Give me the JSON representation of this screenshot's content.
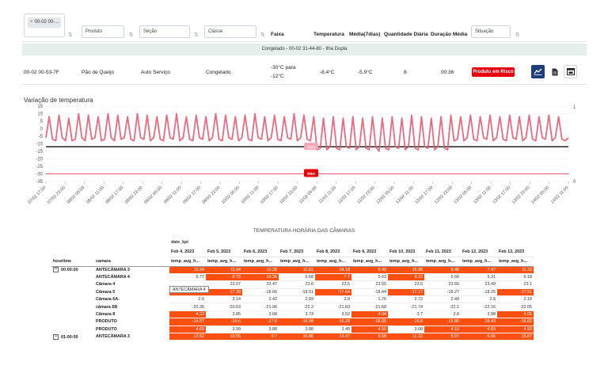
{
  "filters": {
    "chip_value": "00-02 00-...",
    "produto_placeholder": "Produto",
    "secao_placeholder": "Seção",
    "classe_placeholder": "Classe",
    "situacao_placeholder": "Situação"
  },
  "columns": {
    "faixa": "Faixa",
    "temperatura": "Temperatura",
    "media": "Média(7dias)",
    "quantidade": "Quantidade Diária",
    "duracao": "Duração Média"
  },
  "group_band": "Congelado - 00-02 31-44-80 - Ilha Dupla",
  "row": {
    "id": "00-02 00-53-7F",
    "produto": "Pão de Queijo",
    "secao": "Auto Serviço",
    "classe": "Congelado",
    "faixa_line1": "-30°C para",
    "faixa_line2": "-12°C",
    "temperatura": "-8.4°C",
    "media": "-5.9°C",
    "quantidade": "8",
    "duracao": "00:36",
    "situacao": "Produto em Risco"
  },
  "icons": {
    "chart": "line-chart-icon",
    "doc": "document-icon",
    "window": "window-icon",
    "close": "close-icon",
    "sort": "sort-icon"
  },
  "colors": {
    "series": "#e85a71",
    "max_line": "#111111",
    "min_line": "#e85a71",
    "risk_badge": "#e8000b",
    "accent_button": "#1f3d7a",
    "cell_hot": "#fc4f10"
  },
  "chart_data": {
    "type": "line",
    "title": "Variação de temperatura",
    "ylim": [
      -35,
      15
    ],
    "yticks": [
      15,
      10,
      5,
      0,
      -5,
      -10,
      -15,
      -20,
      -25,
      -30,
      -35
    ],
    "secondary_yticks": [
      "1",
      "0"
    ],
    "x_tick_labels": [
      "07/02 17:00",
      "07/02 23:00",
      "08/02 05:00",
      "08/02 11:00",
      "08/02 17:00",
      "08/02 23:00",
      "09/02 05:00",
      "09/02 11:00",
      "09/02 17:00",
      "09/02 23:00",
      "10/02 05:00",
      "10/02 11:00",
      "10/02 17:00",
      "10/02 23:00",
      "11/02 05:00",
      "11/02 11:00",
      "11/02 17:00",
      "11/02 23:00",
      "12/02 05:00",
      "12/02 11:00",
      "12/02 17:00",
      "12/02 23:00",
      "13/02 05:00",
      "13/02 11:00",
      "13/02 17:00",
      "13/02 23:00",
      "14/02 05:00",
      "14/02 11:00"
    ],
    "max_line": -12,
    "min_line": -30,
    "max_label": "max",
    "min_label": "min",
    "series": [
      {
        "values": [
          -6,
          8,
          -7,
          -8,
          9,
          -6,
          -8,
          7,
          -8,
          -7,
          10,
          -6,
          -8,
          9,
          -7,
          -6,
          8,
          -8,
          -7,
          10,
          -6,
          -8,
          9,
          -7,
          -6,
          8,
          -7,
          -8,
          10,
          -6,
          -7,
          9,
          -8,
          -6,
          8,
          -7,
          -8,
          9,
          -6,
          -7,
          10,
          -8,
          -6,
          8,
          -7,
          -8,
          9,
          -6,
          -7,
          8,
          -8,
          -6,
          10,
          -7,
          -8,
          9,
          -6,
          -7,
          8,
          -8,
          -6,
          9,
          -7,
          -8,
          10,
          -6,
          -7,
          8,
          -8,
          -6,
          9,
          -7,
          -8,
          8,
          -6,
          -7,
          10,
          -8,
          -6,
          9,
          -7,
          -8,
          8,
          -14,
          -13,
          7,
          -14,
          -12,
          8,
          -13,
          -14,
          7,
          -12,
          -13,
          8,
          -14,
          -12,
          7,
          -13,
          -14,
          8,
          -12,
          -15,
          7,
          -13,
          -14,
          8,
          -12,
          -13,
          7,
          -14,
          -12,
          9,
          -13,
          -14,
          8,
          -12,
          -13,
          7,
          -14,
          -12,
          8,
          -13,
          -14,
          9,
          -8,
          -7,
          8,
          -8,
          -6,
          9,
          -7,
          -8,
          8,
          -6,
          -7,
          9,
          -8,
          -6,
          8,
          -7,
          -8,
          9,
          -6,
          -7,
          8,
          -8,
          -6,
          9,
          -7,
          -8,
          8,
          -6,
          -7,
          9,
          -8,
          -6,
          8,
          -7,
          -8,
          -6
        ]
      }
    ]
  },
  "kpi_table": {
    "title": "TEMPERATURA HORÁRIA DAS CÂMARAS",
    "pivot_label": "date_kpi",
    "row_header_hourtime": "hourtime",
    "row_header_camara": "camara",
    "dates": [
      "Feb 4, 2023",
      "Feb 5, 2023",
      "Feb 6, 2023",
      "Feb 7, 2023",
      "Feb 8, 2023",
      "Feb 9, 2023",
      "Feb 10, 2023",
      "Feb 11, 2023",
      "Feb 12, 2023",
      "Feb 13, 2023"
    ],
    "metric": "temp_avg_h...",
    "tooltip": "ANTECÂMARA 4",
    "groups": [
      {
        "hour": "00:00:00",
        "rows": [
          {
            "camara": "ANTECÂMARA 3",
            "values": [
              "11.94",
              "11.94",
              "11.28",
              "11.81",
              "14.18",
              "9.49",
              "15.98",
              "8.48",
              "7.47",
              "11.33"
            ],
            "hot": [
              1,
              1,
              1,
              1,
              1,
              1,
              1,
              1,
              1,
              1
            ]
          },
          {
            "camara": "ANTECÂMARA 4",
            "values": [
              "6.77",
              "8.73",
              "10.36",
              "6.68",
              "7.7",
              "5.63",
              "9.22",
              "5.66",
              "5.31",
              "6.18"
            ],
            "hot": [
              0,
              1,
              1,
              0,
              1,
              0,
              1,
              0,
              0,
              0
            ]
          },
          {
            "camara": "Câmara 4",
            "values": [
              "",
              "23.07",
              "23.47",
              "23.6",
              "23.5",
              "23.55",
              "23.6",
              "23.66",
              "23.49",
              "23.1"
            ],
            "hot": [
              0,
              0,
              0,
              0,
              0,
              0,
              0,
              0,
              0,
              0
            ]
          },
          {
            "camara": "Câmara 5",
            "values": [
              "-16.84",
              "-17.39",
              "-18.66",
              "-18.51",
              "-17.64",
              "-18.44",
              "-17.17",
              "-18.27",
              "-18.25",
              "-17.91"
            ],
            "hot": [
              1,
              1,
              0,
              0,
              1,
              0,
              1,
              0,
              0,
              1
            ]
          },
          {
            "camara": "Câmara 6A-",
            "values": [
              "2.6",
              "3.14",
              "2.42",
              "2.89",
              "2.8",
              "1.76",
              "2.72",
              "2.49",
              "2.5",
              "2.18"
            ],
            "hot": [
              0,
              0,
              0,
              0,
              0,
              0,
              0,
              0,
              0,
              0
            ]
          },
          {
            "camara": "câmara 6B",
            "values": [
              "-20.35",
              "-20.63",
              "-21.96",
              "-22.2",
              "-21.83",
              "-21.68",
              "-21.74",
              "-22.1",
              "-22.16",
              "-22.05"
            ],
            "hot": [
              0,
              0,
              0,
              0,
              0,
              0,
              0,
              0,
              0,
              0
            ]
          },
          {
            "camara": "Câmara 8",
            "values": [
              "4.22",
              "3.85",
              "3.68",
              "3.73",
              "3.52",
              "4.04",
              "3.7",
              "3.8",
              "3.98",
              "4.05"
            ],
            "hot": [
              1,
              0,
              0,
              0,
              0,
              1,
              0,
              0,
              0,
              1
            ]
          },
          {
            "camara": "PRODUTO",
            "values": [
              "-14.57",
              "-15.6",
              "-17.6",
              "-16.58",
              "-16.28",
              "-16.05",
              "-15.8",
              "-15.85",
              "-16.43",
              "-16.82"
            ],
            "hot": [
              1,
              1,
              1,
              1,
              1,
              1,
              1,
              1,
              1,
              1
            ]
          },
          {
            "camara": "PRODUTO",
            "values": [
              "4.69",
              "3.99",
              "3.88",
              "3.88",
              "3.48",
              "4.55",
              "3.68",
              "4.16",
              "4.83",
              "4.93"
            ],
            "hot": [
              1,
              0,
              0,
              0,
              0,
              1,
              0,
              1,
              1,
              1
            ]
          }
        ]
      },
      {
        "hour": "01:00:00",
        "rows": [
          {
            "camara": "ANTECÂMARA 3",
            "values": [
              "13.52",
              "10.55",
              "9.7",
              "10.86",
              "13.47",
              "9.68",
              "11.22",
              "8.97",
              "6.66",
              "15.87"
            ],
            "hot": [
              1,
              1,
              1,
              1,
              1,
              1,
              1,
              1,
              1,
              1
            ]
          }
        ]
      }
    ]
  }
}
